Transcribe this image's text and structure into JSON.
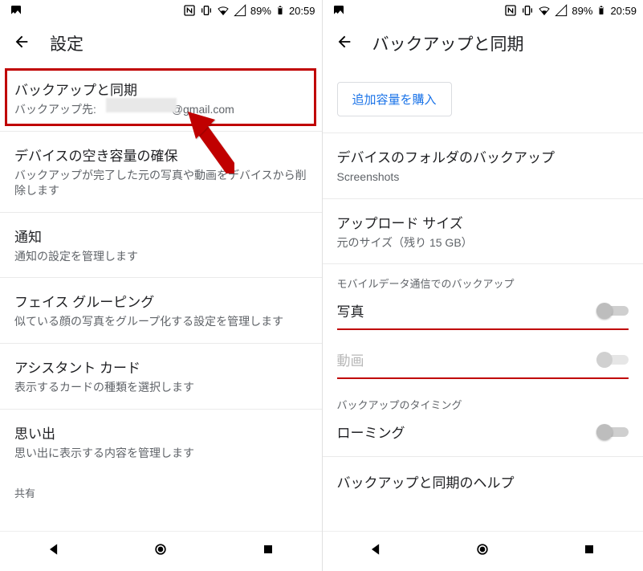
{
  "status": {
    "battery": "89%",
    "time": "20:59"
  },
  "left": {
    "title": "設定",
    "rows": [
      {
        "primary": "バックアップと同期",
        "secondary_prefix": "バックアップ先: ",
        "secondary_suffix": "@gmail.com"
      },
      {
        "primary": "デバイスの空き容量の確保",
        "secondary": "バックアップが完了した元の写真や動画をデバイスから削除します"
      },
      {
        "primary": "通知",
        "secondary": "通知の設定を管理します"
      },
      {
        "primary": "フェイス グルーピング",
        "secondary": "似ている顔の写真をグループ化する設定を管理します"
      },
      {
        "primary": "アシスタント カード",
        "secondary": "表示するカードの種類を選択します"
      },
      {
        "primary": "思い出",
        "secondary": "思い出に表示する内容を管理します"
      }
    ],
    "share_label": "共有"
  },
  "right": {
    "title": "バックアップと同期",
    "buy_storage": "追加容量を購入",
    "device_folders": {
      "primary": "デバイスのフォルダのバックアップ",
      "secondary": "Screenshots"
    },
    "upload_size": {
      "primary": "アップロード サイズ",
      "secondary": "元のサイズ（残り 15 GB）"
    },
    "mobile_section": "モバイルデータ通信でのバックアップ",
    "photos": "写真",
    "videos": "動画",
    "timing_section": "バックアップのタイミング",
    "roaming": "ローミング",
    "help": "バックアップと同期のヘルプ"
  }
}
